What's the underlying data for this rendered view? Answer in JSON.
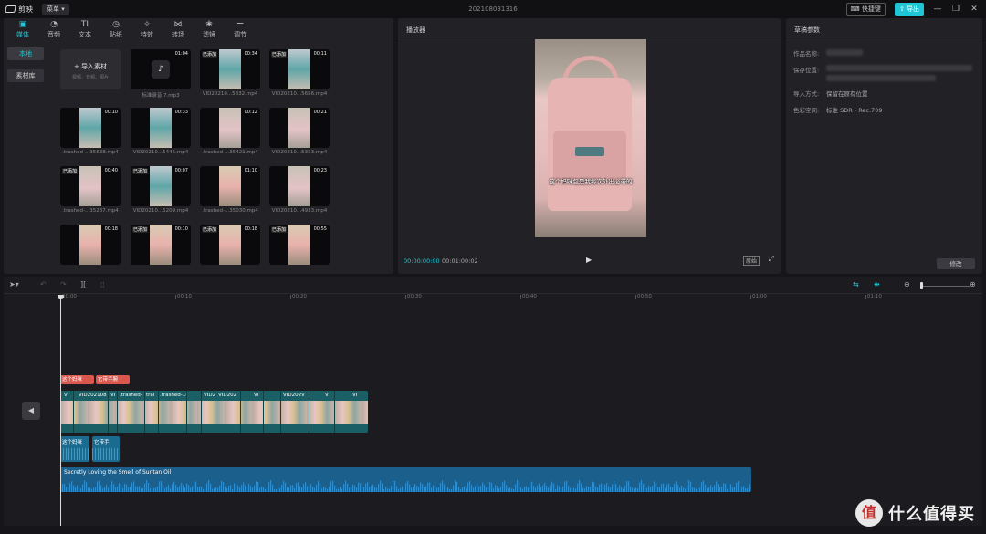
{
  "titlebar": {
    "app_name": "剪映",
    "menu_label": "菜单",
    "doc_title": "202108031316",
    "shortcut_label": "快捷键",
    "export_label": "导出"
  },
  "media_tabs": [
    {
      "label": "媒体",
      "icon": "media-icon",
      "active": true
    },
    {
      "label": "音频",
      "icon": "audio-icon"
    },
    {
      "label": "文本",
      "icon": "text-icon"
    },
    {
      "label": "贴纸",
      "icon": "sticker-icon"
    },
    {
      "label": "特效",
      "icon": "effects-icon"
    },
    {
      "label": "转场",
      "icon": "transition-icon"
    },
    {
      "label": "滤镜",
      "icon": "filter-icon"
    },
    {
      "label": "调节",
      "icon": "adjust-icon"
    }
  ],
  "sidebar": {
    "local": "本地",
    "library": "素材库"
  },
  "import": {
    "label": "导入素材",
    "sub": "视频、音频、图片"
  },
  "media_items": [
    {
      "name": "标准录音 7.mp3",
      "duration": "01:04",
      "type": "audio"
    },
    {
      "name": "VID20210...5832.mp4",
      "duration": "00:34",
      "added": "已添加"
    },
    {
      "name": "VID20210...5656.mp4",
      "duration": "00:11",
      "added": "已添加"
    },
    {
      "name": ".trashed-...35638.mp4",
      "duration": "00:10"
    },
    {
      "name": "VID20210...5445.mp4",
      "duration": "00:33"
    },
    {
      "name": ".trashed-...35421.mp4",
      "duration": "00:12"
    },
    {
      "name": "VID20210...5353.mp4",
      "duration": "00:21"
    },
    {
      "name": ".trashed-...35237.mp4",
      "duration": "00:40",
      "added": "已添加"
    },
    {
      "name": "VID20210...5209.mp4",
      "duration": "00:07",
      "added": "已添加"
    },
    {
      "name": ".trashed-...35030.mp4",
      "duration": "01:10"
    },
    {
      "name": "VID20210...4933.mp4",
      "duration": "00:23"
    },
    {
      "name": "",
      "duration": "00:18"
    },
    {
      "name": "",
      "duration": "00:10",
      "added": "已添加"
    },
    {
      "name": "",
      "duration": "00:18",
      "added": "已添加"
    },
    {
      "name": "",
      "duration": "00:55",
      "added": "已添加"
    }
  ],
  "player": {
    "title": "播放器",
    "subtitle": "这个妈咪包是我每次外出必带的",
    "current_time": "00:00:00:00",
    "total_time": "00:01:00:02",
    "ratio_label": "原始"
  },
  "draft": {
    "title": "草稿参数",
    "name_label": "作品名称:",
    "save_label": "保存位置:",
    "import_label": "导入方式:",
    "import_value": "保留在原有位置",
    "color_label": "色彩空间:",
    "color_value": "标准 SDR - Rec.709",
    "edit_label": "修改"
  },
  "timeline": {
    "ticks": [
      "00:00",
      "00:10",
      "00:20",
      "00:30",
      "00:40",
      "00:50",
      "01:00",
      "01:10"
    ],
    "text_clips": [
      "这个妈咪",
      "它带手腕"
    ],
    "video_labels": [
      "V",
      "VID202108",
      "VI",
      ".trashed-",
      "trai",
      ".trashed-1(",
      "VID2",
      "VID202",
      "VI",
      "VID202",
      "V",
      "V",
      "VI"
    ],
    "sub_clips": [
      "这个妈咪",
      "它带手"
    ],
    "music_title": "Secretly Loving the Smell of Suntan Oil"
  },
  "watermark": {
    "logo": "值",
    "text": "什么值得买"
  },
  "colors": {
    "accent": "#1fc6d6",
    "text_clip": "#d9574d",
    "video_track": "#1a5f66",
    "audio_track": "#1b5f8c"
  }
}
